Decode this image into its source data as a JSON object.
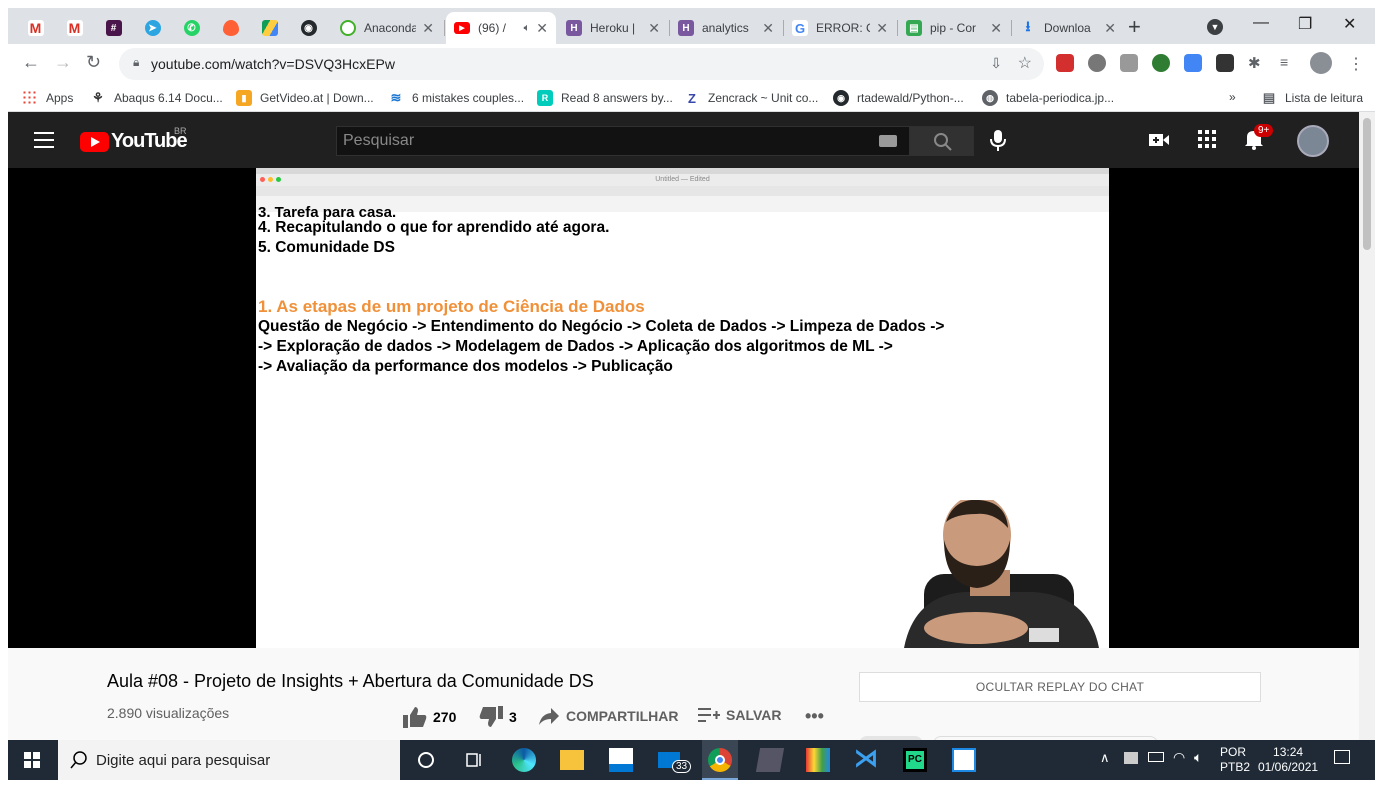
{
  "browser": {
    "tabs": [
      {
        "title": "",
        "icon": "gmail-icon",
        "pinned": true
      },
      {
        "title": "",
        "icon": "gmail-icon",
        "pinned": true
      },
      {
        "title": "",
        "icon": "slack-icon",
        "pinned": true
      },
      {
        "title": "",
        "icon": "telegram-icon",
        "pinned": true
      },
      {
        "title": "",
        "icon": "whatsapp-icon",
        "pinned": true
      },
      {
        "title": "",
        "icon": "tinder-icon",
        "pinned": true
      },
      {
        "title": "",
        "icon": "google-drive-icon",
        "pinned": true
      },
      {
        "title": "",
        "icon": "github-icon",
        "pinned": true
      },
      {
        "title": "Anaconda",
        "icon": "anaconda-icon"
      },
      {
        "title": "(96) /",
        "icon": "youtube-icon",
        "active": true
      },
      {
        "title": "Heroku |",
        "icon": "heroku-icon"
      },
      {
        "title": "analytics",
        "icon": "heroku-icon"
      },
      {
        "title": "ERROR: C",
        "icon": "google-icon"
      },
      {
        "title": "pip - Cor",
        "icon": "spreadsheet-icon"
      },
      {
        "title": "Downloa",
        "icon": "download-icon"
      }
    ],
    "url": "youtube.com/watch?v=DSVQ3HcxEPw",
    "bookmarks": [
      {
        "label": "Apps",
        "icon": "apps-grid-icon"
      },
      {
        "label": "Abaqus 6.14 Docu...",
        "icon": "abaqus-icon"
      },
      {
        "label": "GetVideo.at | Down...",
        "icon": "getvideo-icon"
      },
      {
        "label": "6 mistakes couples...",
        "icon": "feather-icon"
      },
      {
        "label": "Read 8 answers by...",
        "icon": "researchgate-icon"
      },
      {
        "label": "Zencrack ~ Unit co...",
        "icon": "zencrack-icon"
      },
      {
        "label": "rtadewald/Python-...",
        "icon": "github-icon"
      },
      {
        "label": "tabela-periodica.jp...",
        "icon": "globe-icon"
      }
    ],
    "reading_list": "Lista de leitura"
  },
  "youtube": {
    "logo_text": "YouTube",
    "country": "BR",
    "search_placeholder": "Pesquisar",
    "notifications": "9+",
    "video": {
      "doc_cut_line": "3. Tarefa para casa.",
      "doc_lines": [
        "4. Recapitulando o que for aprendido até agora.",
        "5. Comunidade DS"
      ],
      "doc_heading": "1. As etapas de um projeto de Ciência de Dados",
      "doc_steps": [
        "Questão de Negócio -> Entendimento do Negócio ->  Coleta de Dados -> Limpeza de Dados ->",
        "-> Exploração de dados -> Modelagem de Dados -> Aplicação dos algoritmos de ML ->",
        "-> Avaliação da performance dos modelos -> Publicação"
      ],
      "mac_window_title": "Untitled — Edited"
    },
    "title": "Aula #08 - Projeto de Insights + Abertura da Comunidade DS",
    "views": "2.890 visualizações",
    "likes": "270",
    "dislikes": "3",
    "share_label": "COMPARTILHAR",
    "save_label": "SALVAR",
    "chat_button": "OCULTAR REPLAY DO CHAT"
  },
  "taskbar": {
    "search_placeholder": "Digite aqui para pesquisar",
    "mail_badge": "33",
    "lang_top": "POR",
    "lang_bottom": "PTB2",
    "time": "13:24",
    "date": "01/06/2021"
  }
}
